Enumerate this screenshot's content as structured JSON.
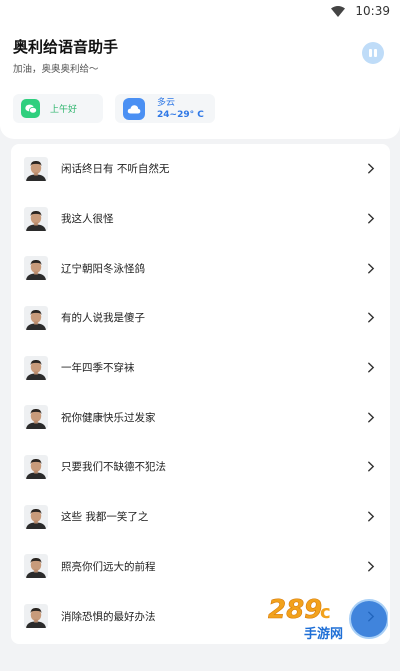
{
  "status_bar": {
    "time": "10:39"
  },
  "header": {
    "title": "奥利给语音助手",
    "subtitle": "加油，奥奥奥利给～"
  },
  "widgets": {
    "greeting": {
      "label": "上午好",
      "icon": "chat-icon"
    },
    "weather": {
      "condition": "多云",
      "temperature": "24~29° C",
      "icon": "cloud-icon"
    }
  },
  "list": {
    "items": [
      {
        "label": "闲话终日有 不听自然无"
      },
      {
        "label": "我这人很怪"
      },
      {
        "label": "辽宁朝阳冬泳怪鸽"
      },
      {
        "label": "有的人说我是傻子"
      },
      {
        "label": "一年四季不穿袜"
      },
      {
        "label": "祝你健康快乐过发家"
      },
      {
        "label": "只要我们不缺德不犯法"
      },
      {
        "label": "这些 我都一笑了之"
      },
      {
        "label": "照亮你们远大的前程"
      },
      {
        "label": "消除恐惧的最好办法"
      }
    ]
  },
  "watermark": {
    "number": "289",
    "suffix": "c",
    "text": "手游网"
  },
  "colors": {
    "accent_blue": "#4b90f3",
    "accent_green": "#2fcf7e",
    "background": "#f2f3f5"
  }
}
